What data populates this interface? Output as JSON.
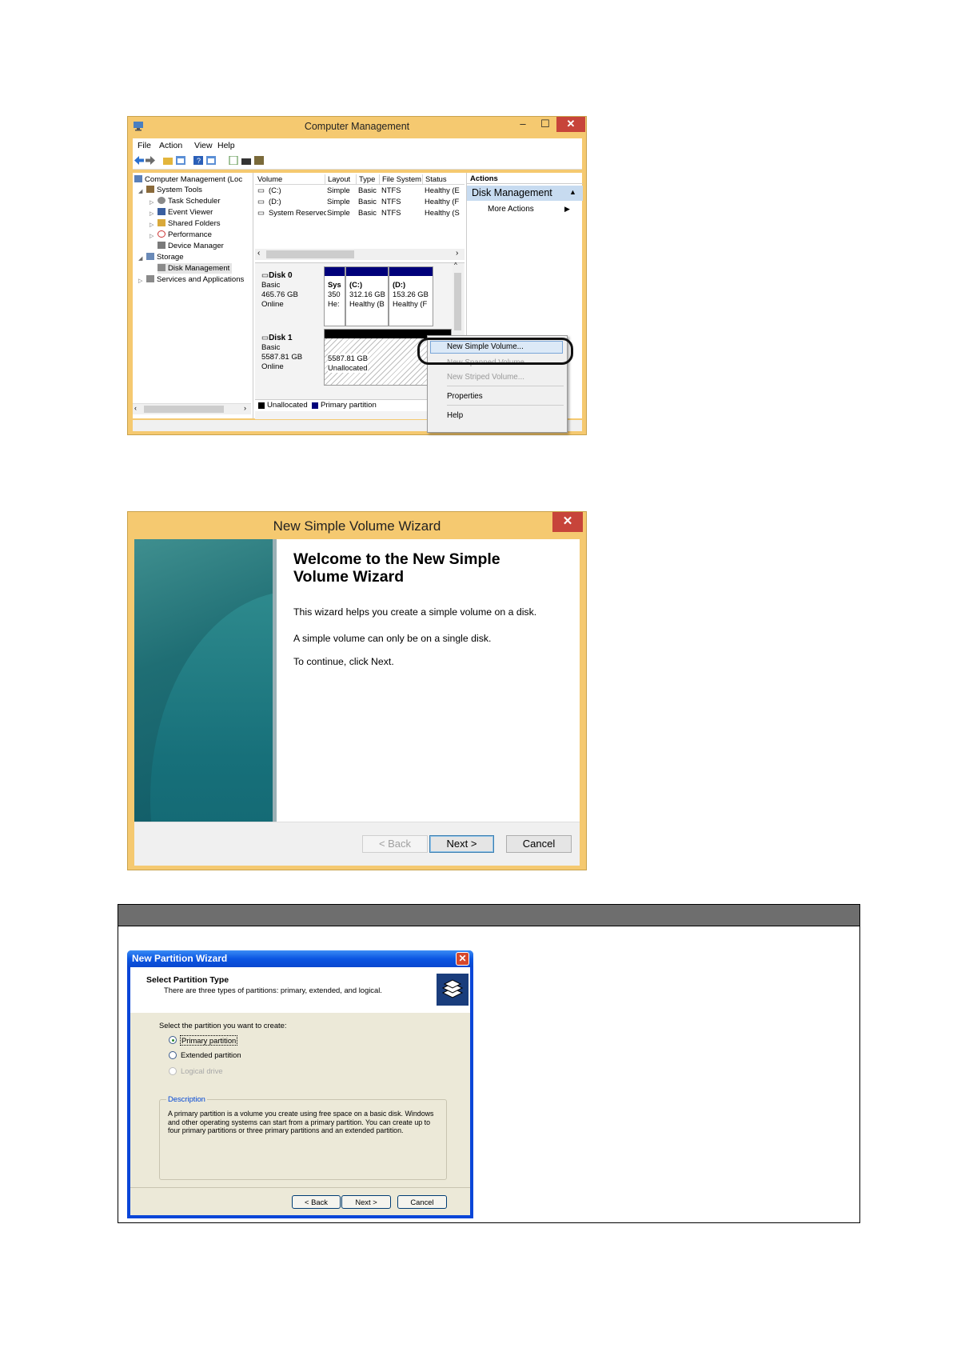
{
  "computer_management": {
    "title": "Computer Management",
    "controls": {
      "minimize": "–",
      "maximize": "☐",
      "close": "✕"
    },
    "menu": [
      "File",
      "Action",
      "View",
      "Help"
    ],
    "tree": {
      "root": "Computer Management (Loc",
      "system_tools": "System Tools",
      "task_scheduler": "Task Scheduler",
      "event_viewer": "Event Viewer",
      "shared_folders": "Shared Folders",
      "performance": "Performance",
      "device_manager": "Device Manager",
      "storage": "Storage",
      "disk_management": "Disk Management",
      "services": "Services and Applications"
    },
    "volume_columns": [
      "Volume",
      "Layout",
      "Type",
      "File System",
      "Status"
    ],
    "volumes": [
      {
        "volume": "(C:)",
        "layout": "Simple",
        "type": "Basic",
        "fs": "NTFS",
        "status": "Healthy (E"
      },
      {
        "volume": "(D:)",
        "layout": "Simple",
        "type": "Basic",
        "fs": "NTFS",
        "status": "Healthy (F"
      },
      {
        "volume": "System Reserved",
        "layout": "Simple",
        "type": "Basic",
        "fs": "NTFS",
        "status": "Healthy (S"
      }
    ],
    "disk0": {
      "name": "Disk 0",
      "kind": "Basic",
      "size": "465.76 GB",
      "state": "Online",
      "parts": [
        {
          "line1": "Sys",
          "line2": "350",
          "line3": "He:"
        },
        {
          "line1": "(C:)",
          "line2": "312.16 GB",
          "line3": "Healthy (B"
        },
        {
          "line1": "(D:)",
          "line2": "153.26 GB",
          "line3": "Healthy (F"
        }
      ]
    },
    "disk1": {
      "name": "Disk 1",
      "kind": "Basic",
      "size": "5587.81 GB",
      "state": "Online",
      "unalloc_size": "5587.81 GB",
      "unalloc_label": "Unallocated"
    },
    "legend": {
      "unallocated": "Unallocated",
      "primary": "Primary partition"
    },
    "actions": {
      "header": "Actions",
      "selected": "Disk Management",
      "more": "More Actions"
    },
    "context_menu": {
      "new_simple": "New Simple Volume...",
      "new_spanned": "New Spanned Volume...",
      "new_striped": "New Striped Volume...",
      "properties": "Properties",
      "help": "Help"
    },
    "colors": {
      "frame": "#f5c970",
      "primary_band": "#00007a",
      "close": "#c7443a"
    }
  },
  "simple_volume_wizard": {
    "title": "New Simple Volume Wizard",
    "close": "✕",
    "heading": "Welcome to the New Simple Volume Wizard",
    "p1": "This wizard helps you create a simple volume on a disk.",
    "p2": "A simple volume can only be on a single disk.",
    "p3": "To continue, click Next.",
    "buttons": {
      "back": "< Back",
      "next": "Next >",
      "cancel": "Cancel"
    }
  },
  "partition_wizard": {
    "title": "New Partition Wizard",
    "close": "✕",
    "section_title": "Select Partition Type",
    "section_subtitle": "There are three types of partitions: primary, extended, and logical.",
    "prompt": "Select the partition you want to create:",
    "options": {
      "primary": "Primary partition",
      "extended": "Extended partition",
      "logical": "Logical drive"
    },
    "selected_option": "Primary partition",
    "description_label": "Description",
    "description": "A primary partition is a volume you create using free space on a basic disk. Windows and other operating systems can start from a primary partition. You can create up to four primary partitions or three primary partitions and an extended partition.",
    "buttons": {
      "back": "< Back",
      "next": "Next >",
      "cancel": "Cancel"
    }
  }
}
